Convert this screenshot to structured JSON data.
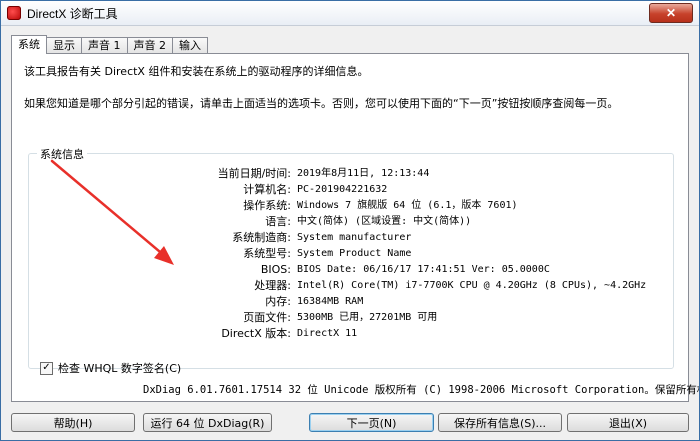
{
  "window": {
    "title": "DirectX 诊断工具",
    "close_label": "✕"
  },
  "tabs": [
    {
      "label": "系统",
      "active": true
    },
    {
      "label": "显示",
      "active": false
    },
    {
      "label": "声音 1",
      "active": false
    },
    {
      "label": "声音 2",
      "active": false
    },
    {
      "label": "输入",
      "active": false
    }
  ],
  "intro": {
    "line1": "该工具报告有关 DirectX 组件和安装在系统上的驱动程序的详细信息。",
    "line2": "如果您知道是哪个部分引起的错误，请单击上面适当的选项卡。否则，您可以使用下面的“下一页”按钮按顺序查阅每一页。"
  },
  "system_info": {
    "legend": "系统信息",
    "rows": [
      {
        "label": "当前日期/时间:",
        "value": "2019年8月11日, 12:13:44"
      },
      {
        "label": "计算机名:",
        "value": "PC-201904221632"
      },
      {
        "label": "操作系统:",
        "value": "Windows 7 旗舰版 64 位 (6.1，版本 7601)"
      },
      {
        "label": "语言:",
        "value": "中文(简体) (区域设置: 中文(简体))"
      },
      {
        "label": "系统制造商:",
        "value": "System manufacturer"
      },
      {
        "label": "系统型号:",
        "value": "System Product Name"
      },
      {
        "label": "BIOS:",
        "value": "BIOS Date: 06/16/17 17:41:51 Ver: 05.0000C"
      },
      {
        "label": "处理器:",
        "value": "Intel(R) Core(TM) i7-7700K CPU @ 4.20GHz (8 CPUs), ~4.2GHz"
      },
      {
        "label": "内存:",
        "value": "16384MB RAM"
      },
      {
        "label": "页面文件:",
        "value": "5300MB 已用，27201MB 可用"
      },
      {
        "label": "DirectX 版本:",
        "value": "DirectX 11"
      }
    ]
  },
  "whql": {
    "checked": true,
    "check_mark": "✓",
    "label": "检查 WHQL 数字签名(C)"
  },
  "footer": "DxDiag 6.01.7601.17514 32 位 Unicode 版权所有 (C) 1998-2006 Microsoft Corporation。保留所有权",
  "buttons": {
    "help": "帮助(H)",
    "run64": "运行 64 位 DxDiag(R)",
    "next": "下一页(N)",
    "save": "保存所有信息(S)...",
    "exit": "退出(X)"
  },
  "colors": {
    "annotation_arrow": "#e8302a",
    "close_button": "#c7422b"
  }
}
